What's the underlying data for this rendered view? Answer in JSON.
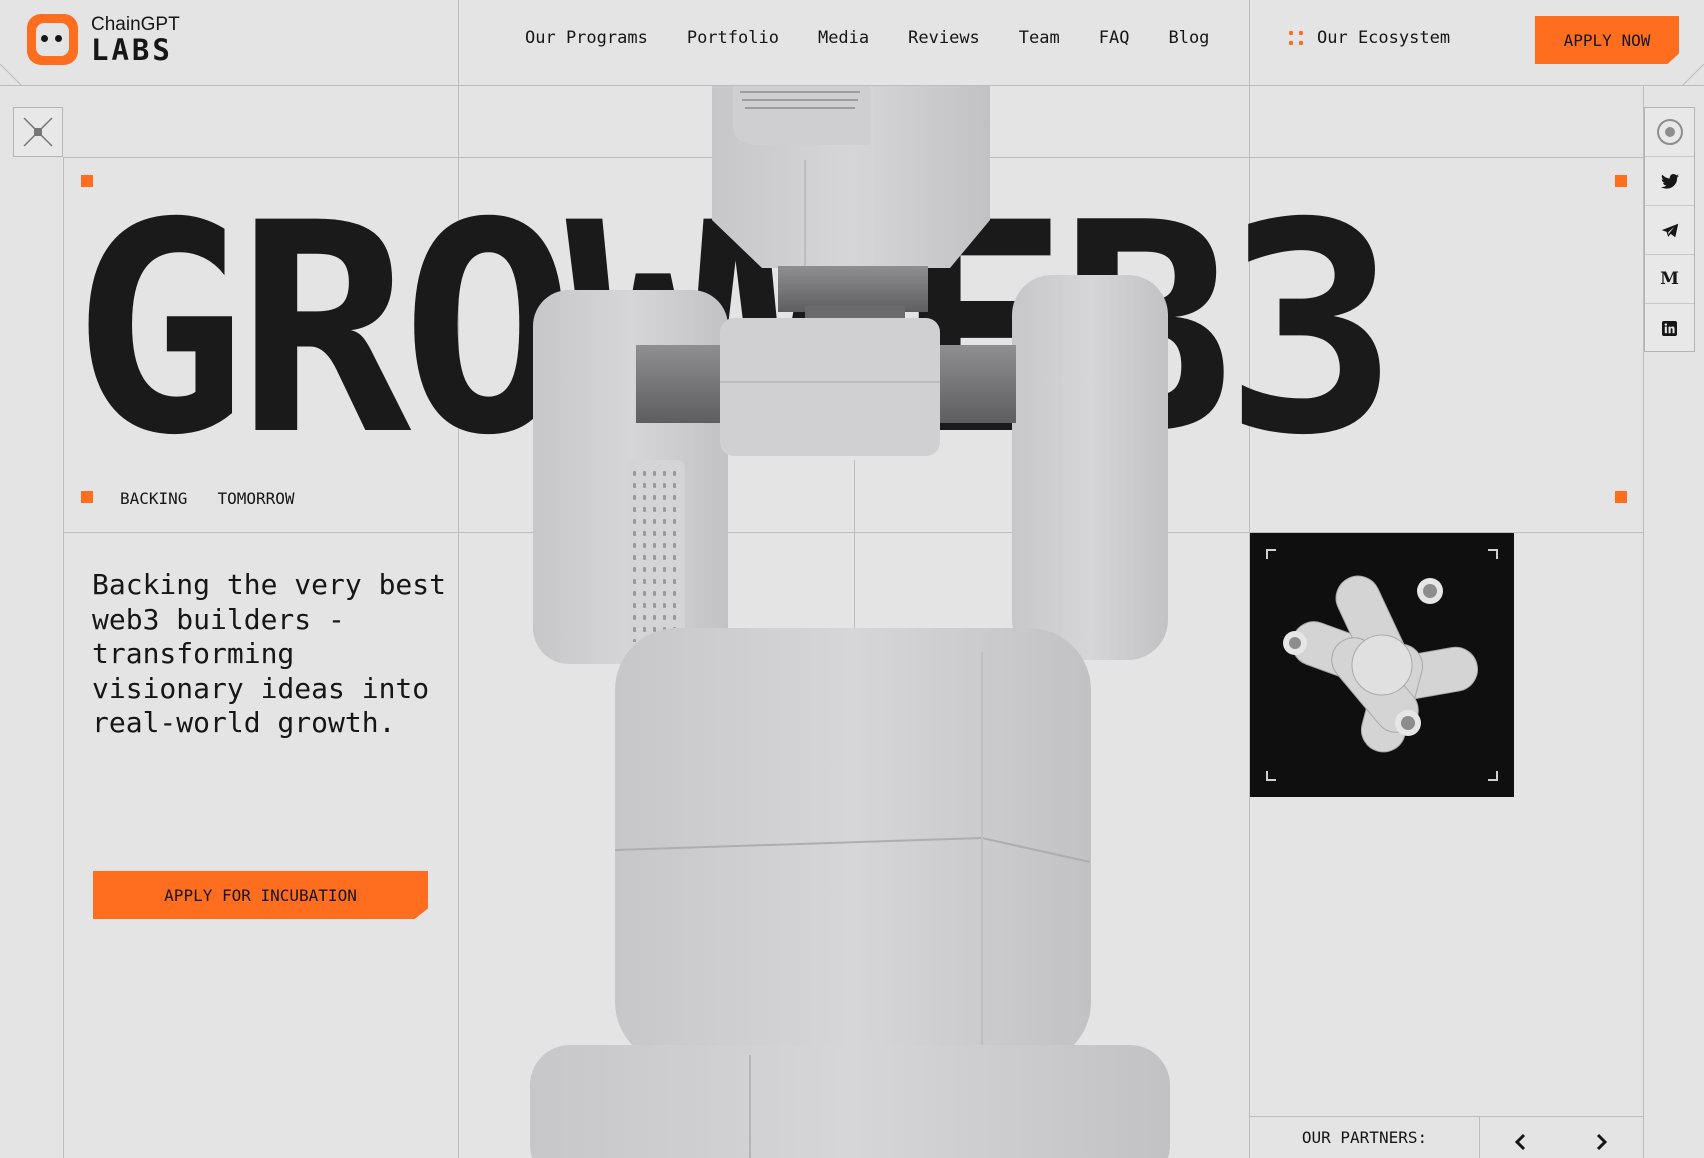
{
  "brand": {
    "name_top": "ChainGPT",
    "name_bottom": "LABS",
    "accent": "#ff6d1f"
  },
  "nav": {
    "items": [
      {
        "label": "Our Programs"
      },
      {
        "label": "Portfolio"
      },
      {
        "label": "Media"
      },
      {
        "label": "Reviews"
      },
      {
        "label": "Team"
      },
      {
        "label": "FAQ"
      },
      {
        "label": "Blog"
      }
    ],
    "ecosystem_label": "Our Ecosystem",
    "apply_label": "APPLY NOW"
  },
  "side_icons": [
    "target-icon",
    "twitter-icon",
    "telegram-icon",
    "medium-icon",
    "linkedin-icon"
  ],
  "hero": {
    "big_word": "GROWWEB3",
    "tag_1": "BACKING",
    "tag_2": "TOMORROW",
    "description": "Backing the very best web3 builders - transforming visionary ideas into real-world growth.",
    "cta_label": "APPLY FOR INCUBATION"
  },
  "partners": {
    "label": "OUR PARTNERS:"
  }
}
